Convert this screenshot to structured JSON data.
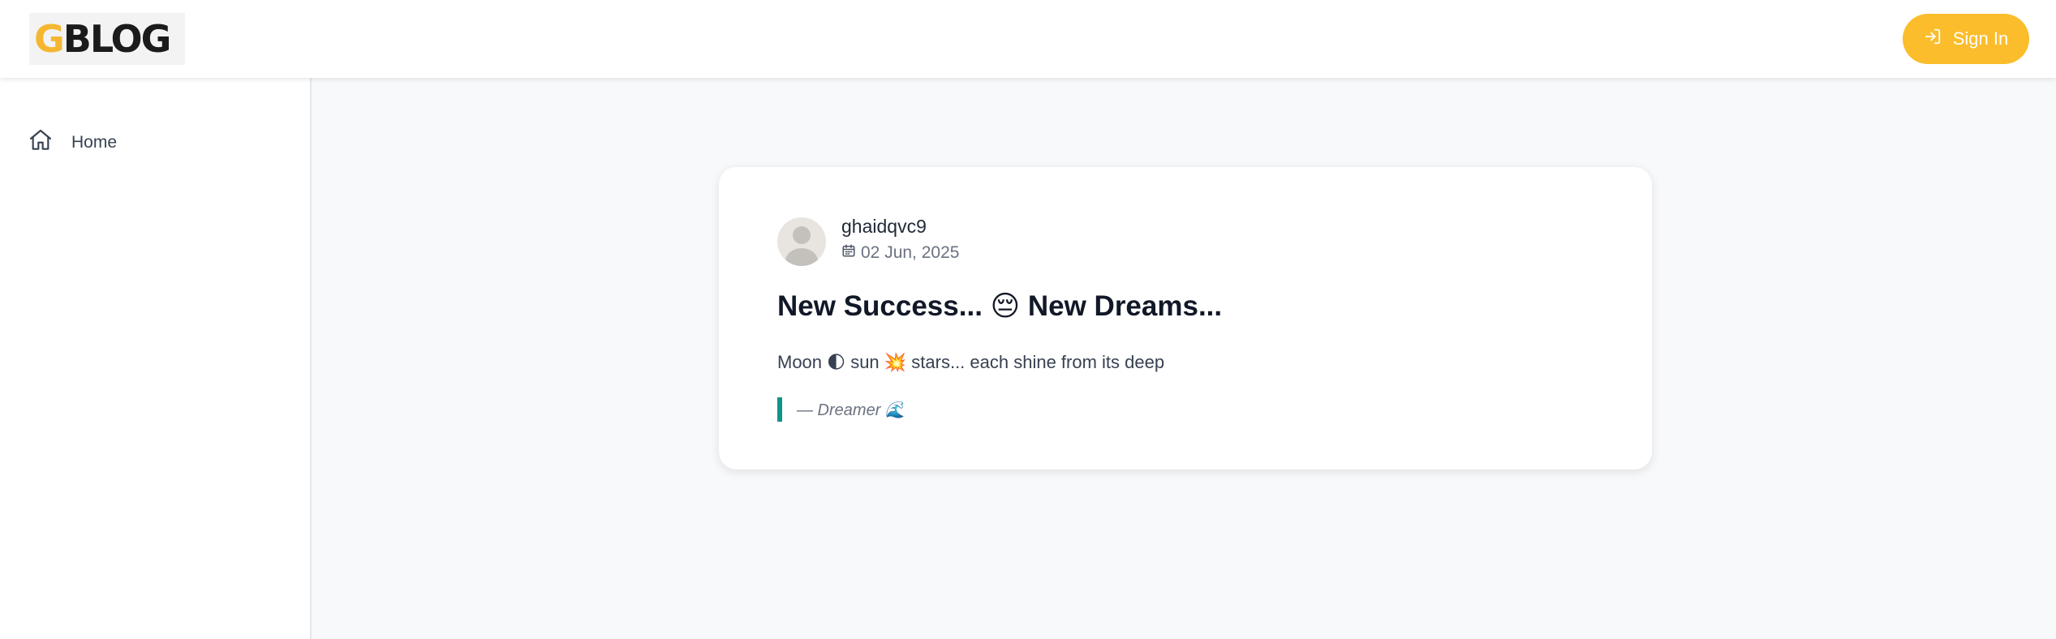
{
  "header": {
    "logo_first_letter": "G",
    "logo_rest": "BLOG",
    "signin_label": "Sign In",
    "signin_icon": "sign-in-icon",
    "accent_color": "#fbbd2b"
  },
  "sidebar": {
    "items": [
      {
        "label": "Home",
        "icon": "home-icon"
      }
    ]
  },
  "post": {
    "author": "ghaidqvc9",
    "date": "02 Jun, 2025",
    "title": "New Success... 😔 New Dreams...",
    "body": "Moon 🌓 sun 💥 stars... each shine from its deep",
    "quote": "— Dreamer 🌊",
    "quote_border_color": "#0f9488"
  }
}
